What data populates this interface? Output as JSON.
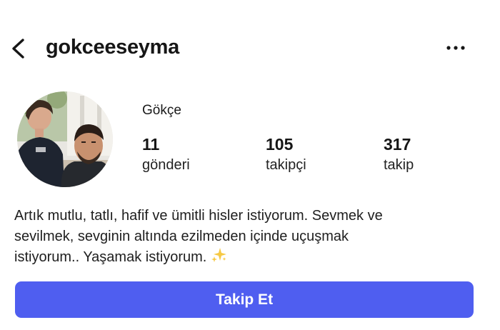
{
  "header": {
    "username": "gokceeseyma",
    "back_icon": "chevron-left-icon",
    "more_icon": "more-horizontal-icon"
  },
  "profile": {
    "display_name": "Gökçe",
    "stats": [
      {
        "value": "11",
        "label": "gönderi"
      },
      {
        "value": "105",
        "label": "takipçi"
      },
      {
        "value": "317",
        "label": "takip"
      }
    ],
    "bio_lines": [
      "Artık mutlu, tatlı, hafif ve ümitli hisler istiyorum. Sevmek ve",
      "sevilmek, sevginin altında ezilmeden içinde uçuşmak",
      "istiyorum.. Yaşamak istiyorum."
    ],
    "bio_emoji": "sparkles-icon"
  },
  "actions": {
    "follow_label": "Takip Et"
  },
  "colors": {
    "accent": "#4f5ef0",
    "text": "#1a1a1a"
  }
}
